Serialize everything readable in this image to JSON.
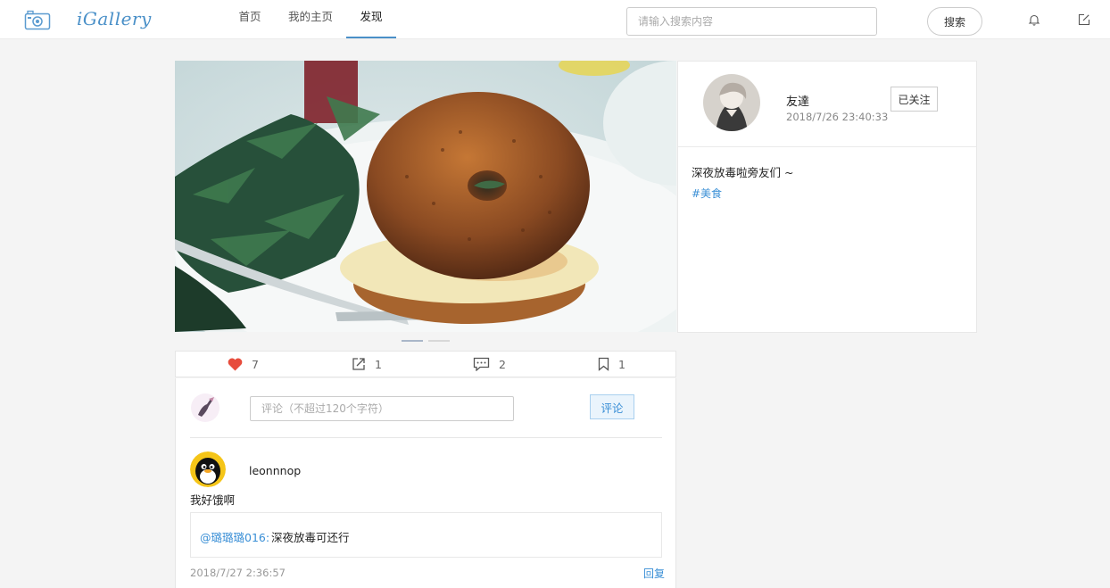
{
  "header": {
    "logo_text": "iGallery",
    "nav": [
      {
        "label": "首页"
      },
      {
        "label": "我的主页"
      },
      {
        "label": "发现"
      }
    ],
    "search_placeholder": "请输入搜索内容",
    "search_label": "搜索"
  },
  "carousel": {
    "slide_count": 2,
    "active_index": 0
  },
  "post": {
    "author": "友達",
    "time": "2018/7/26 23:40:33",
    "follow_label": "已关注",
    "caption": "深夜放毒啦旁友们 ~",
    "tag": "#美食"
  },
  "actions": {
    "likes": "7",
    "shares": "1",
    "comments": "2",
    "bookmarks": "1"
  },
  "comment_form": {
    "placeholder": "评论（不超过120个字符）",
    "submit_label": "评论"
  },
  "comments": [
    {
      "user": "leonnnop",
      "text": "我好饿啊",
      "reply_user": "@璐璐璐016:",
      "reply_text": "深夜放毒可还行",
      "time": "2018/7/27 2:36:57",
      "reply_label": "回复"
    }
  ],
  "colors": {
    "accent": "#3a8fd6",
    "like": "#e74c3c"
  }
}
